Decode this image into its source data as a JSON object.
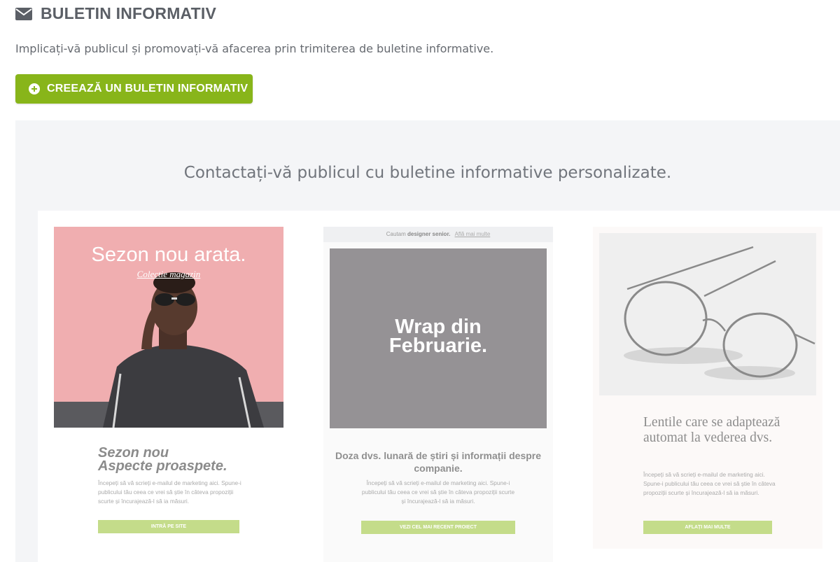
{
  "header": {
    "icon": "envelope-icon",
    "title": "BULETIN INFORMATIV"
  },
  "subtitle": "Implicați-vă publicul și promovați-vă afacerea prin trimiterea de buletine informative.",
  "cta": {
    "icon": "plus-circle-icon",
    "label": "CREEAZĂ UN BULETIN INFORMATIV",
    "color": "#88b51a"
  },
  "showcase": {
    "title": "Contactați-vă publicul cu buletine informative personalizate.",
    "templates": [
      {
        "hero_title": "Sezon nou arata.",
        "hero_link": "Colectie magazin",
        "hero_color": "#f0aeb0",
        "heading_line1": "Sezon nou",
        "heading_line2": "Aspecte proaspete.",
        "body": "Începeți să vă scrieți e-mailul de marketing aici. Spune-i publicului tău ceea ce vrei să știe în câteva propoziții scurte și încurajează-l să ia măsuri.",
        "button": "INTRĂ PE SITE"
      },
      {
        "bar_text": "Cautam",
        "bar_bold": "designer senior.",
        "bar_link": "Află mai multe",
        "hero_line1": "Wrap din",
        "hero_line2": "Februarie.",
        "hero_color": "#959295",
        "heading": "Doza dvs. lunară de știri și informații despre companie.",
        "body": "Începeți să vă scrieți e-mailul de marketing aici. Spune-i publicului tău ceea ce vrei să știe în câteva propoziții scurte și încurajează-l să ia măsuri.",
        "button": "VEZI CEL MAI RECENT PROIECT"
      },
      {
        "image": "eyeglasses-image",
        "heading": "Lentile care se adaptează automat la vederea dvs.",
        "body": "Începeți să vă scrieți e-mailul de marketing aici. Spune-i publicului tău ceea ce vrei să știe în câteva propoziții scurte și încurajează-l să ia măsuri.",
        "button": "AFLAȚI MAI MULTE"
      }
    ]
  }
}
